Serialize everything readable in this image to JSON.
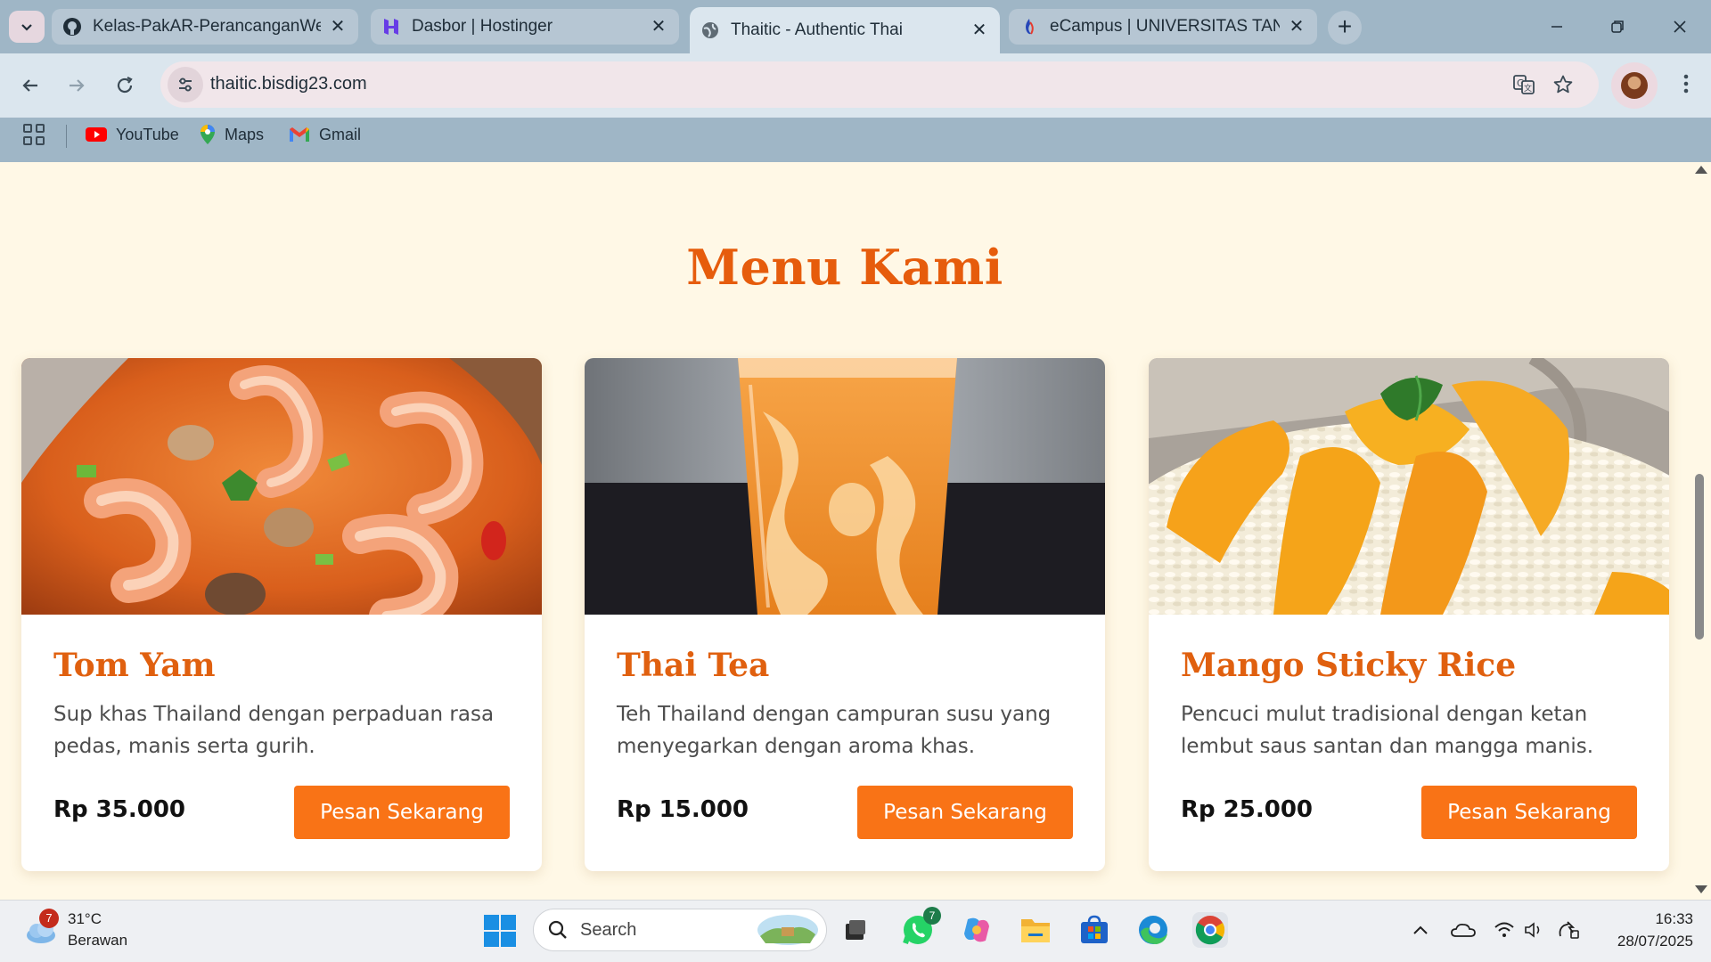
{
  "browser": {
    "tabs": [
      {
        "title": "Kelas-PakAR-PerancanganWebD",
        "favicon": "github-icon",
        "active": false
      },
      {
        "title": "Dasbor | Hostinger",
        "favicon": "hostinger-icon",
        "active": false
      },
      {
        "title": "Thaitic - Authentic Thai",
        "favicon": "globe-icon",
        "active": true
      },
      {
        "title": "eCampus | UNIVERSITAS TANGE",
        "favicon": "ecampus-icon",
        "active": false
      }
    ],
    "url": "thaitic.bisdig23.com",
    "bookmarks": [
      {
        "label": "YouTube",
        "icon": "youtube-icon"
      },
      {
        "label": "Maps",
        "icon": "maps-icon"
      },
      {
        "label": "Gmail",
        "icon": "gmail-icon"
      }
    ]
  },
  "page": {
    "section_title": "Menu Kami",
    "menu_items": [
      {
        "name": "Tom Yam",
        "description": "Sup khas Thailand dengan perpaduan rasa pedas, manis serta gurih.",
        "price": "Rp 35.000",
        "button": "Pesan Sekarang",
        "image": "tom-yam-photo"
      },
      {
        "name": "Thai Tea",
        "description": "Teh Thailand dengan campuran susu yang menyegarkan dengan aroma khas.",
        "price": "Rp 15.000",
        "button": "Pesan Sekarang",
        "image": "thai-tea-photo"
      },
      {
        "name": "Mango Sticky Rice",
        "description": "Pencuci mulut tradisional dengan ketan lembut saus santan dan mangga manis.",
        "price": "Rp 25.000",
        "button": "Pesan Sekarang",
        "image": "mango-sticky-rice-photo"
      }
    ],
    "colors": {
      "accent": "#e65c0c",
      "button": "#f97316",
      "background": "#fff8e6"
    }
  },
  "taskbar": {
    "weather": {
      "temp": "31°C",
      "condition": "Berawan",
      "badge": "7"
    },
    "search_label": "Search",
    "whatsapp_badge": "7",
    "time": "16:33",
    "date": "28/07/2025"
  }
}
